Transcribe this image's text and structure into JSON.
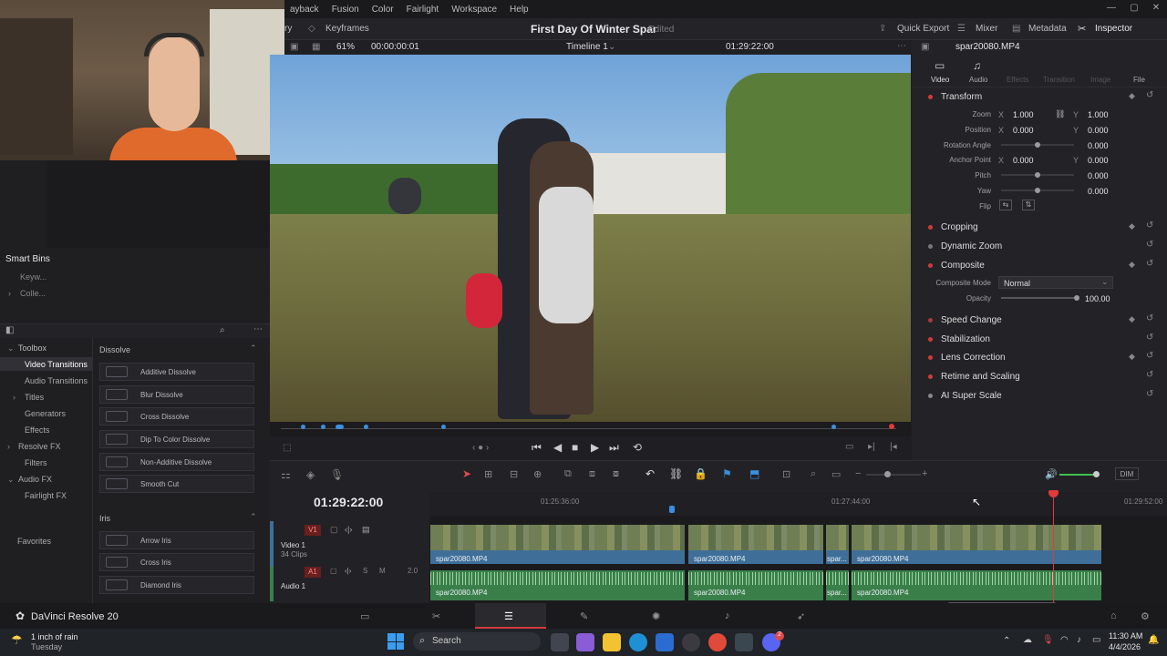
{
  "menu": {
    "items": [
      "ayback",
      "Fusion",
      "Color",
      "Fairlight",
      "Workspace",
      "Help"
    ]
  },
  "toolbar": {
    "keyframes": "Keyframes",
    "quick_export": "Quick Export",
    "mixer": "Mixer",
    "metadata": "Metadata",
    "inspector": "Inspector",
    "left_partial": "ry"
  },
  "project": {
    "title": "First Day Of Winter Spar",
    "status": "Edited"
  },
  "viewer": {
    "zoom": "61%",
    "timecode_left": "00:00:00:01",
    "timeline_name": "Timeline 1",
    "timecode_right": "01:29:22:00"
  },
  "inspector": {
    "clip": "spar20080.MP4",
    "tabs": [
      "Video",
      "Audio",
      "Effects",
      "Transition",
      "Image",
      "File"
    ],
    "transform": {
      "title": "Transform",
      "zoom_label": "Zoom",
      "zoom_x": "1.000",
      "zoom_y": "1.000",
      "position_label": "Position",
      "pos_x": "0.000",
      "pos_y": "0.000",
      "rotation_label": "Rotation Angle",
      "rotation": "0.000",
      "anchor_label": "Anchor Point",
      "anchor_x": "0.000",
      "anchor_y": "0.000",
      "pitch_label": "Pitch",
      "pitch": "0.000",
      "yaw_label": "Yaw",
      "yaw": "0.000",
      "flip_label": "Flip",
      "x_axis": "X",
      "y_axis": "Y"
    },
    "sections": [
      "Cropping",
      "Dynamic Zoom",
      "Composite",
      "Speed Change",
      "Stabilization",
      "Lens Correction",
      "Retime and Scaling",
      "AI Super Scale"
    ],
    "composite": {
      "mode_label": "Composite Mode",
      "mode": "Normal",
      "opacity_label": "Opacity",
      "opacity": "100.00"
    }
  },
  "left": {
    "smart_bins": "Smart Bins",
    "bin1": "Keyw...",
    "bin2": "Colle...",
    "tree": [
      "Toolbox",
      "Video Transitions",
      "Audio Transitions",
      "Titles",
      "Generators",
      "Effects",
      "Resolve FX",
      "Filters",
      "Audio FX",
      "Fairlight FX"
    ],
    "favorites": "Favorites",
    "dissolve_header": "Dissolve",
    "dissolve": [
      "Additive Dissolve",
      "Blur Dissolve",
      "Cross Dissolve",
      "Dip To Color Dissolve",
      "Non-Additive Dissolve",
      "Smooth Cut"
    ],
    "iris_header": "Iris",
    "iris": [
      "Arrow Iris",
      "Cross Iris",
      "Diamond Iris"
    ]
  },
  "timeline": {
    "timecode": "01:29:22:00",
    "ruler": [
      "01:25:36:00",
      "01:27:44:00",
      "01:29:52:00"
    ],
    "v1": "V1",
    "video_track": "Video 1",
    "clip_count": "34 Clips",
    "a1": "A1",
    "audio_track": "Audio 1",
    "audio_level": "2.0",
    "clip_names": [
      "spar20080.MP4",
      "spar20080.MP4",
      "spar...",
      "spar20080.MP4"
    ],
    "dim": "DIM"
  },
  "app": {
    "name": "DaVinci Resolve 20"
  },
  "taskbar": {
    "weather": "1 inch of rain",
    "day": "Tuesday",
    "search": "Search",
    "time": "11:30 AM",
    "date": "4/4/2026",
    "badge": "2"
  },
  "colors": {
    "accent_red": "#d23a3a",
    "clip_blue": "#3f6f98",
    "audio_green": "#3a7f4a"
  }
}
